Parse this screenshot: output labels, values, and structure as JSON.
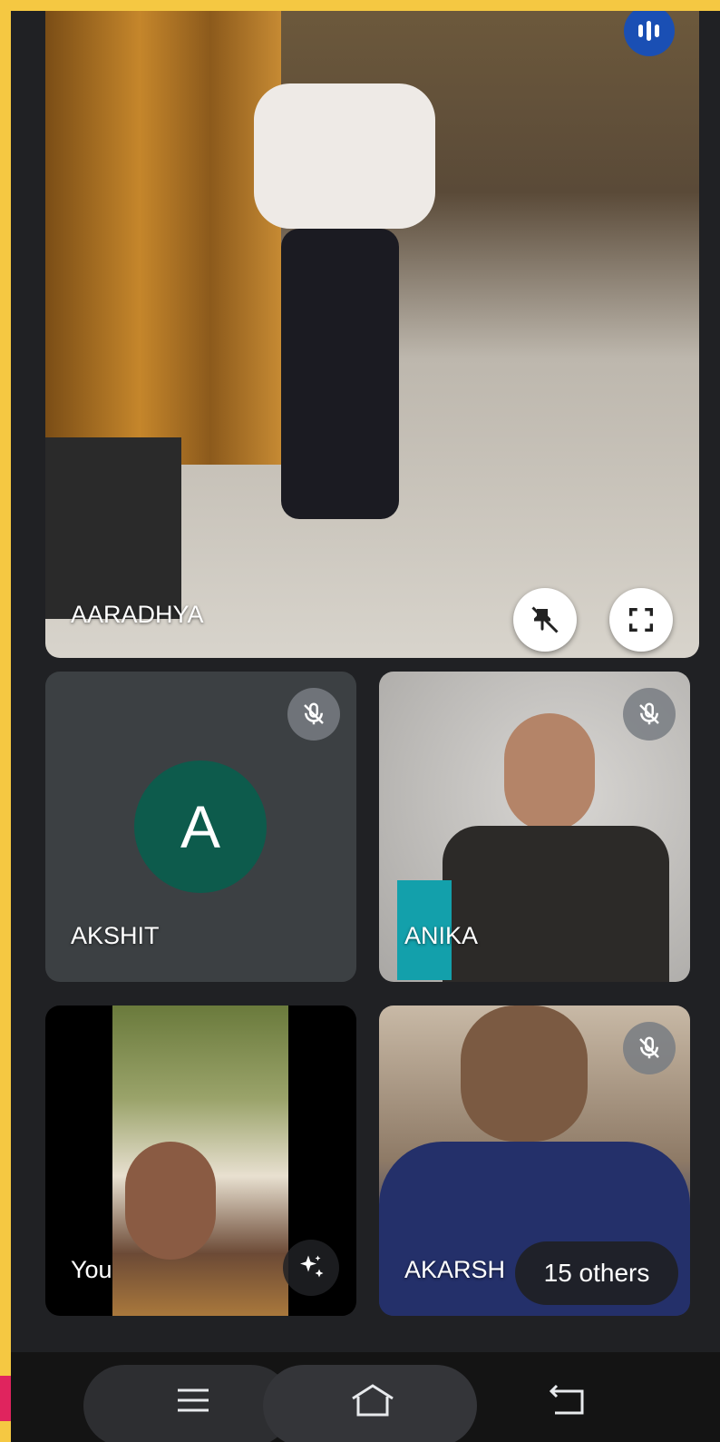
{
  "participants": {
    "main": {
      "name": "AARADHYA"
    },
    "akshit": {
      "name": "AKSHIT",
      "avatar_letter": "A",
      "avatar_color": "#0d5b4c"
    },
    "anika": {
      "name": "ANIKA"
    },
    "you": {
      "name": "You"
    },
    "akarsh": {
      "name": "AKARSH"
    }
  },
  "others_badge": "15 others",
  "icons": {
    "speaking": "audio-level-icon",
    "pin": "unpin-icon",
    "fullscreen": "fullscreen-icon",
    "muted": "mic-off-icon",
    "effects": "sparkle-effects-icon"
  },
  "nav": {
    "menu": "menu-icon",
    "home": "home-icon",
    "back": "back-icon"
  },
  "colors": {
    "background": "#202124",
    "frame": "#f5c842",
    "speaking_badge": "#1a4fb4"
  }
}
